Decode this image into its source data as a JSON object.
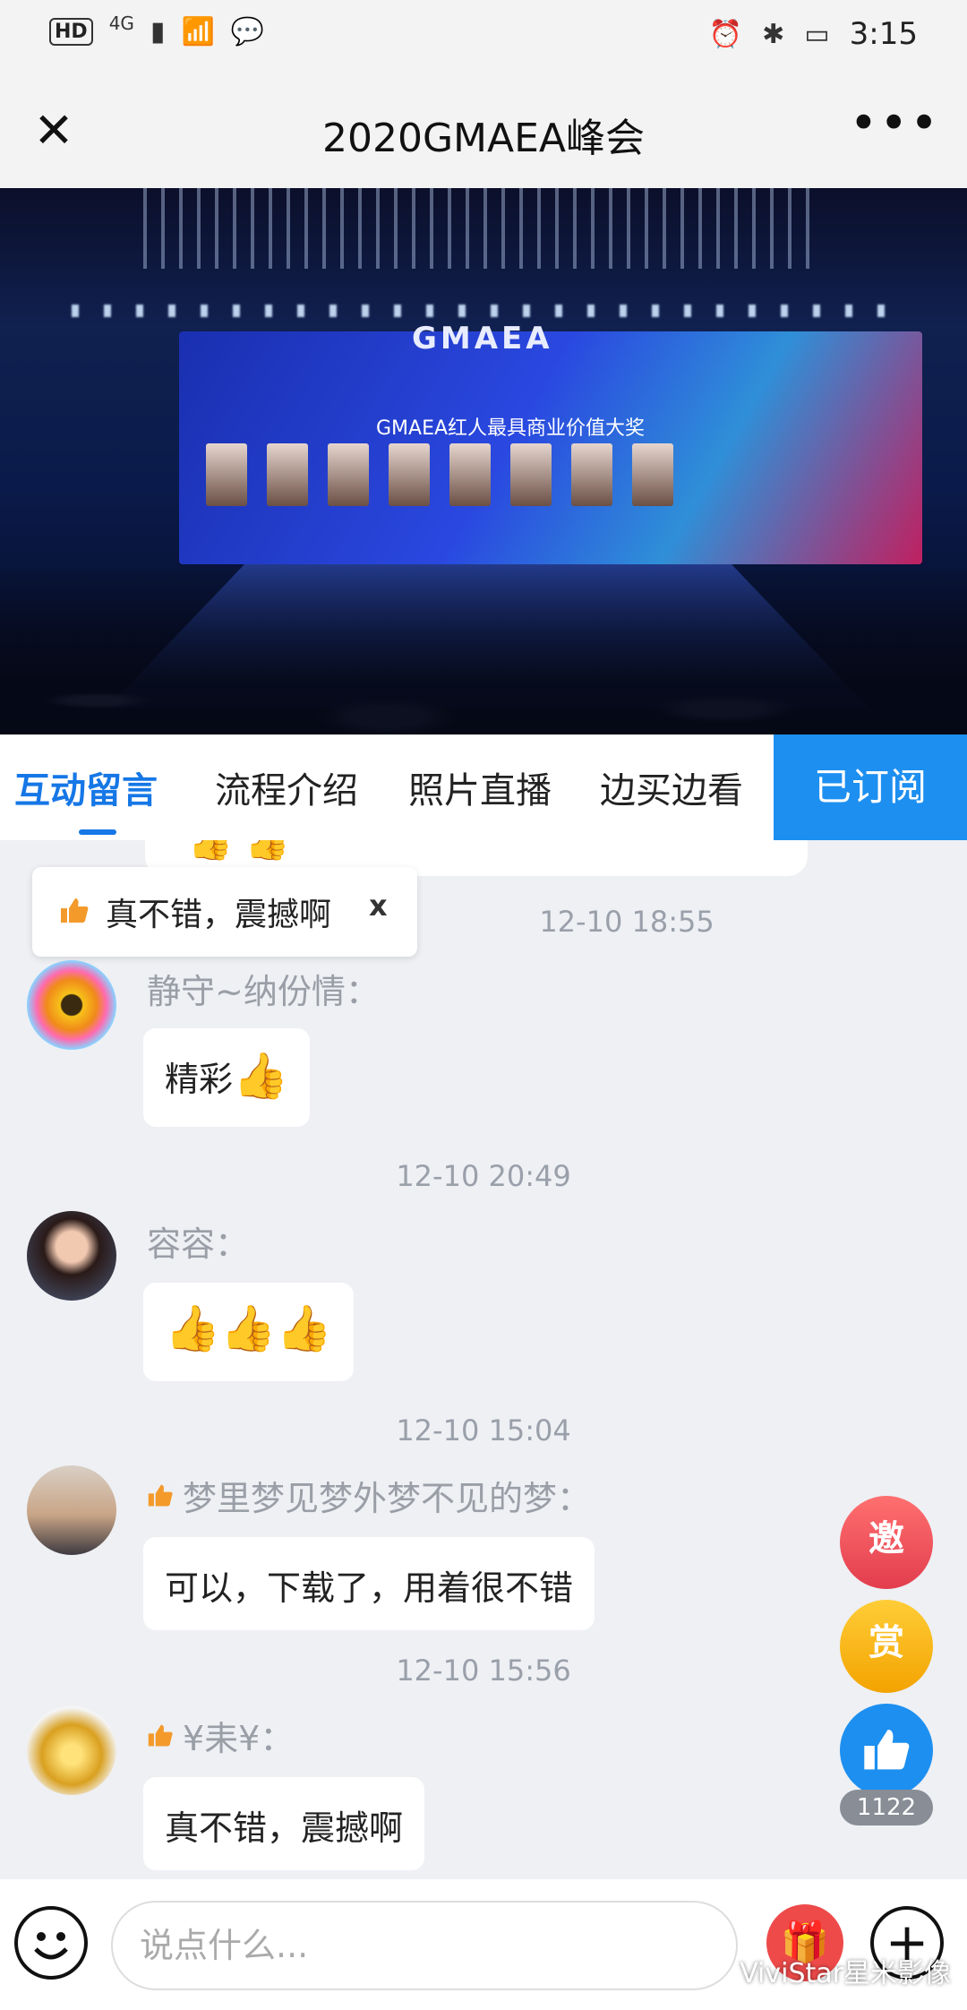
{
  "status_bar": {
    "hd": "HD",
    "network": "4G",
    "time": "3:15"
  },
  "header": {
    "title": "2020GMAEA峰会"
  },
  "hero": {
    "logo_text": "GMAEA",
    "award_title": "GMAEA红人最具商业价值大奖"
  },
  "tabs": [
    {
      "label": "互动留言",
      "active": true
    },
    {
      "label": "流程介绍"
    },
    {
      "label": "照片直播"
    },
    {
      "label": "边买边看"
    }
  ],
  "subscribe_label": "已订阅",
  "toast": {
    "message": "真不错，震撼啊",
    "close": "x"
  },
  "messages": [
    {
      "time": "12-10 18:55",
      "name": "静守~纳份情：",
      "text": "精彩",
      "emoji": "👍"
    },
    {
      "time": "12-10 20:49",
      "name": "容容：",
      "text": "",
      "emoji": "👍👍👍"
    },
    {
      "time": "12-10 15:04",
      "name": "梦里梦见梦外梦不见的梦：",
      "text": "可以，下载了，用着很不错",
      "emoji": ""
    },
    {
      "time": "12-10 15:56",
      "name": "¥耒¥：",
      "text": "真不错，震撼啊",
      "emoji": ""
    }
  ],
  "floating": {
    "invite": "邀",
    "reward": "赏",
    "like_count": "1122"
  },
  "composer": {
    "placeholder": "说点什么..."
  },
  "watermark": "ViviStar星米影像",
  "colors": {
    "accent": "#1677e6",
    "subscribe_bg": "#1d8ff0",
    "invite": "#e23d4d",
    "reward": "#f3a300"
  }
}
